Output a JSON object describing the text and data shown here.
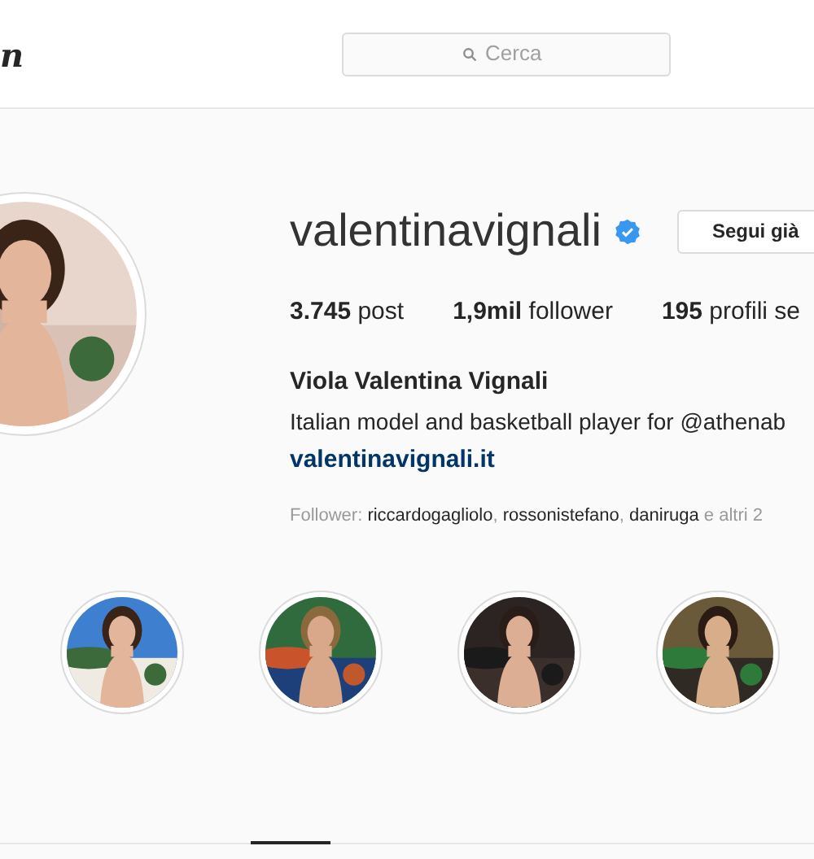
{
  "header": {
    "logo": "n",
    "search": {
      "placeholder": "Cerca"
    }
  },
  "profile": {
    "username": "valentinavignali",
    "verified": true,
    "follow_button": "Segui già",
    "stats": [
      {
        "count": "3.745",
        "label": "post"
      },
      {
        "count": "1,9mil",
        "label": "follower"
      },
      {
        "count": "195",
        "label": "profili se"
      }
    ],
    "full_name": "Viola Valentina Vignali",
    "bio": "Italian model and basketball player for @athenab",
    "website": "valentinavignali.it",
    "followed_by": "Follower: **riccardogagliolo**, **rossonistefano**, **daniruga** e altri 2"
  }
}
